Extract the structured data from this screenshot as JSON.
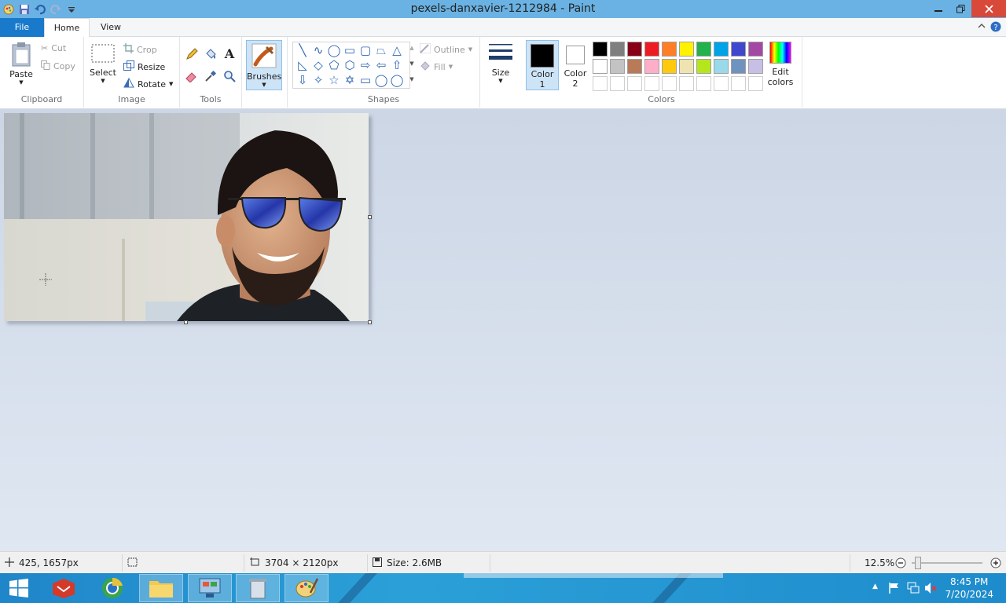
{
  "window": {
    "title": "pexels-danxavier-1212984 - Paint"
  },
  "tabs": {
    "file": "File",
    "home": "Home",
    "view": "View"
  },
  "clipboard": {
    "paste": "Paste",
    "cut": "Cut",
    "copy": "Copy",
    "label": "Clipboard"
  },
  "image": {
    "select": "Select",
    "crop": "Crop",
    "resize": "Resize",
    "rotate": "Rotate",
    "label": "Image"
  },
  "tools": {
    "label": "Tools"
  },
  "brushes": {
    "label": "Brushes"
  },
  "shapes": {
    "outline": "Outline",
    "fill": "Fill",
    "label": "Shapes"
  },
  "size": {
    "label": "Size"
  },
  "colors": {
    "color1_l1": "Color",
    "color1_l2": "1",
    "color2_l1": "Color",
    "color2_l2": "2",
    "edit_l1": "Edit",
    "edit_l2": "colors",
    "label": "Colors",
    "palette_row1": [
      "#000000",
      "#7f7f7f",
      "#880015",
      "#ed1c24",
      "#ff7f27",
      "#fff200",
      "#22b14c",
      "#00a2e8",
      "#3f48cc",
      "#a349a4"
    ],
    "palette_row2": [
      "#ffffff",
      "#c3c3c3",
      "#b97a57",
      "#ffaec9",
      "#ffc90e",
      "#efe4b0",
      "#b5e61d",
      "#99d9ea",
      "#7092be",
      "#c8bfe7"
    ],
    "active_color1": "#000000",
    "active_color2": "#ffffff"
  },
  "status": {
    "cursor_pos": "425, 1657px",
    "dimensions": "3704 × 2120px",
    "size": "Size: 2.6MB",
    "zoom": "12.5%"
  },
  "taskbar": {
    "time": "8:45 PM",
    "date": "7/20/2024"
  }
}
